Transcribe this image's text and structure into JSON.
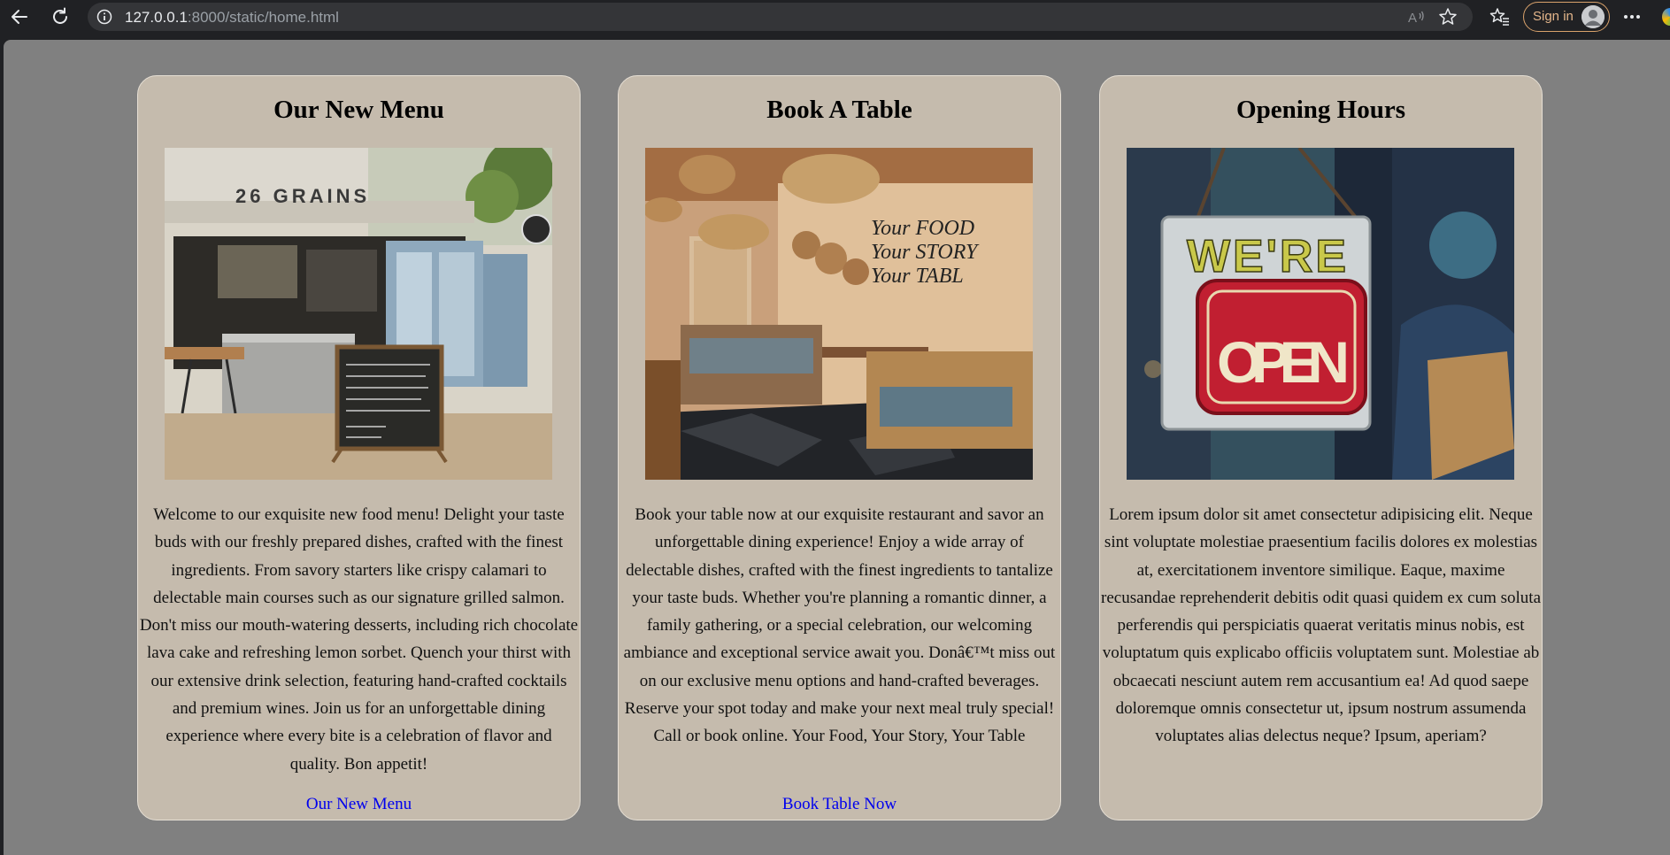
{
  "browser": {
    "url_host": "127.0.0.1",
    "url_rest": ":8000/static/home.html",
    "signin_label": "Sign in"
  },
  "cards": [
    {
      "title": "Our New Menu",
      "photo_text": "26 GRAINS",
      "text": "Welcome to our exquisite new food menu! Delight your taste buds with our freshly prepared dishes, crafted with the finest ingredients. From savory starters like crispy calamari to delectable main courses such as our signature grilled salmon. Don't miss our mouth-watering desserts, including rich chocolate lava cake and refreshing lemon sorbet. Quench your thirst with our extensive drink selection, featuring hand-crafted cocktails and premium wines. Join us for an unforgettable dining experience where every bite is a celebration of flavor and quality. Bon appetit!",
      "link": "Our New Menu"
    },
    {
      "title": "Book A Table",
      "photo_text": "Your FOOD Your STORY Your TABL",
      "text": "Book your table now at our exquisite restaurant and savor an unforgettable dining experience! Enjoy a wide array of delectable dishes, crafted with the finest ingredients to tantalize your taste buds. Whether you're planning a romantic dinner, a family gathering, or a special celebration, our welcoming ambiance and exceptional service await you. Donâ€™t miss out on our exclusive menu options and hand-crafted beverages. Reserve your spot today and make your next meal truly special! Call or book online. Your Food, Your Story, Your Table",
      "link": "Book Table Now"
    },
    {
      "title": "Opening Hours",
      "photo_text": "WE'RE OPEN",
      "text": "Lorem ipsum dolor sit amet consectetur adipisicing elit. Neque sint voluptate molestiae praesentium facilis dolores ex molestias at, exercitationem inventore similique. Eaque, maxime recusandae reprehenderit debitis odit quasi quidem ex cum soluta perferendis qui perspiciatis quaerat veritatis minus nobis, est voluptatum quis explicabo officiis voluptatem sunt. Molestiae ab obcaecati nesciunt autem rem accusantium ea! Ad quod saepe doloremque omnis consectetur ut, ipsum nostrum assumenda voluptates alias delectus neque? Ipsum, aperiam?",
      "link": ""
    }
  ]
}
